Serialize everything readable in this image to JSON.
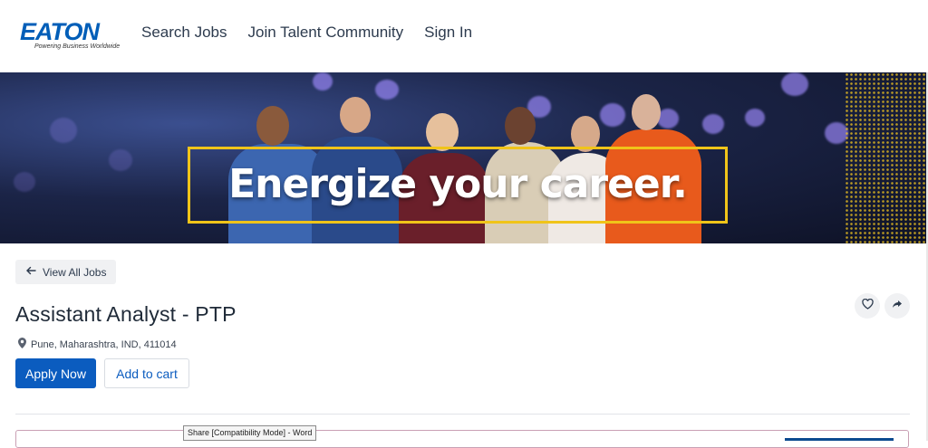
{
  "brand": {
    "name": "EATON",
    "tagline": "Powering Business Worldwide",
    "color": "#005eb8"
  },
  "nav": {
    "items": [
      {
        "label": "Search Jobs"
      },
      {
        "label": "Join Talent Community"
      },
      {
        "label": "Sign In"
      }
    ]
  },
  "banner": {
    "headline": "Energize your career.",
    "frame_color": "#f0c419"
  },
  "job": {
    "back_label": "View All Jobs",
    "title": "Assistant Analyst - PTP",
    "location": "Pune, Maharashtra, IND, 411014",
    "apply_label": "Apply Now",
    "cart_label": "Add to cart",
    "accent": "#0b5cbf"
  },
  "actions": {
    "favorite_icon": "heart-icon",
    "share_icon": "share-icon"
  },
  "taskbar_tooltip": {
    "text": "Share [Compatibility Mode] - Word"
  }
}
